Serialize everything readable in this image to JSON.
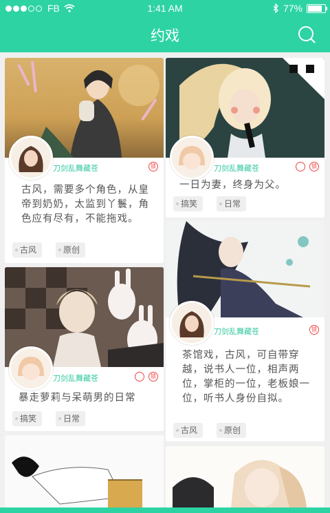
{
  "status": {
    "carrier": "FB",
    "time": "1:41 AM",
    "battery": "77%",
    "battery_level": 0.77
  },
  "nav": {
    "title": "约戏",
    "search_icon": "search-icon"
  },
  "theme": {
    "accent": "#2ed3a4",
    "author": "#35c9a0",
    "icon_red": "#e44"
  },
  "cards": [
    {
      "author": "刀剑乱舞藏苍",
      "desc": "古风，需要多个角色，从皇帝到奶奶，太监到丫鬟，角色应有尽有，不能拖戏。",
      "tags": [
        "古风",
        "原创"
      ],
      "icon_text": "锁"
    },
    {
      "author": "刀剑乱舞藏苍",
      "desc": "一日为妻，终身为父。",
      "tags": [
        "搞笑",
        "日常"
      ],
      "icon_text": "锁"
    },
    {
      "author": "刀剑乱舞藏苍",
      "desc": "茶馆戏，古风，可自带穿越，说书人一位，相声两位，掌柜的一位，老板娘一位，听书人身份自拟。",
      "tags": [
        "古风",
        "原创"
      ],
      "icon_text": "锁"
    },
    {
      "author": "刀剑乱舞藏苍",
      "desc": "暴走萝莉与呆萌男的日常",
      "tags": [
        "搞笑",
        "日常"
      ],
      "icon_text": "锁"
    }
  ]
}
